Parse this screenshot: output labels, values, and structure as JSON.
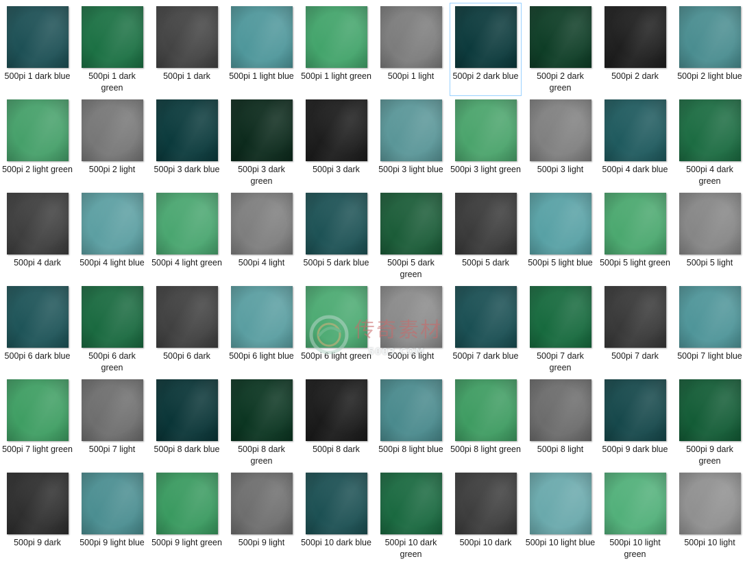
{
  "colors": {
    "dark blue": "#1c4e52",
    "dark green": "#1a6b42",
    "dark": "#3f3f3f",
    "light blue": "#4f9498",
    "light green": "#3fa06a",
    "light": "#7a7a7a",
    "selection_border": "#99d1ff"
  },
  "selected_index": 6,
  "items": [
    {
      "label": "500pi 1 dark blue",
      "swatch": "#1d5055"
    },
    {
      "label": "500pi 1 dark green",
      "swatch": "#1c7144"
    },
    {
      "label": "500pi 1 dark",
      "swatch": "#434343"
    },
    {
      "label": "500pi 1 light blue",
      "swatch": "#4f979b"
    },
    {
      "label": "500pi 1 light green",
      "swatch": "#43a46b"
    },
    {
      "label": "500pi 1 light",
      "swatch": "#7c7c7c"
    },
    {
      "label": "500pi 2 dark blue",
      "swatch": "#0c3a3c"
    },
    {
      "label": "500pi 2 dark green",
      "swatch": "#0e3d26"
    },
    {
      "label": "500pi 2 dark",
      "swatch": "#1e1e1e"
    },
    {
      "label": "500pi 2 light blue",
      "swatch": "#4a8d90"
    },
    {
      "label": "500pi 2 light green",
      "swatch": "#46a06a"
    },
    {
      "label": "500pi 2 light",
      "swatch": "#777777"
    },
    {
      "label": "500pi 3 dark blue",
      "swatch": "#0b3a3c"
    },
    {
      "label": "500pi 3 dark green",
      "swatch": "#0c2a1c"
    },
    {
      "label": "500pi 3 dark",
      "swatch": "#1c1c1c"
    },
    {
      "label": "500pi 3 light blue",
      "swatch": "#5a9698"
    },
    {
      "label": "500pi 3 light green",
      "swatch": "#4ba46c"
    },
    {
      "label": "500pi 3 light",
      "swatch": "#808080"
    },
    {
      "label": "500pi 4 dark blue",
      "swatch": "#1f5a5e"
    },
    {
      "label": "500pi 4 dark green",
      "swatch": "#1c6c42"
    },
    {
      "label": "500pi 4 dark",
      "swatch": "#3e3e3e"
    },
    {
      "label": "500pi 4 light blue",
      "swatch": "#5c9fa2"
    },
    {
      "label": "500pi 4 light green",
      "swatch": "#4aa670"
    },
    {
      "label": "500pi 4 light",
      "swatch": "#7e7e7e"
    },
    {
      "label": "500pi 5 dark blue",
      "swatch": "#1d5255"
    },
    {
      "label": "500pi 5 dark green",
      "swatch": "#1b5c38"
    },
    {
      "label": "500pi 5 dark",
      "swatch": "#3a3a3a"
    },
    {
      "label": "500pi 5 light blue",
      "swatch": "#58a1a5"
    },
    {
      "label": "500pi 5 light green",
      "swatch": "#4ba86f"
    },
    {
      "label": "500pi 5 light",
      "swatch": "#868686"
    },
    {
      "label": "500pi 6 dark blue",
      "swatch": "#1e5458"
    },
    {
      "label": "500pi 6 dark green",
      "swatch": "#1a6a40"
    },
    {
      "label": "500pi 6 dark",
      "swatch": "#404040"
    },
    {
      "label": "500pi 6 light blue",
      "swatch": "#5a9ea1"
    },
    {
      "label": "500pi 6 light green",
      "swatch": "#4caa72"
    },
    {
      "label": "500pi 6 light",
      "swatch": "#8a8a8a"
    },
    {
      "label": "500pi 7 dark blue",
      "swatch": "#1a4f53"
    },
    {
      "label": "500pi 7 dark green",
      "swatch": "#176a3e"
    },
    {
      "label": "500pi 7 dark",
      "swatch": "#383838"
    },
    {
      "label": "500pi 7 light blue",
      "swatch": "#4f9599"
    },
    {
      "label": "500pi 7 light green",
      "swatch": "#3f9e63"
    },
    {
      "label": "500pi 7 light",
      "swatch": "#6e6e6e"
    },
    {
      "label": "500pi 8 dark blue",
      "swatch": "#0a3537"
    },
    {
      "label": "500pi 8 dark green",
      "swatch": "#0b3521"
    },
    {
      "label": "500pi 8 dark",
      "swatch": "#1a1a1a"
    },
    {
      "label": "500pi 8 light blue",
      "swatch": "#4a8a8d"
    },
    {
      "label": "500pi 8 light green",
      "swatch": "#3f9c62"
    },
    {
      "label": "500pi 8 light",
      "swatch": "#6c6c6c"
    },
    {
      "label": "500pi 9 dark blue",
      "swatch": "#16484b"
    },
    {
      "label": "500pi 9 dark green",
      "swatch": "#135c36"
    },
    {
      "label": "500pi 9 dark",
      "swatch": "#2e2e2e"
    },
    {
      "label": "500pi 9 light blue",
      "swatch": "#4b8e91"
    },
    {
      "label": "500pi 9 light green",
      "swatch": "#3a9a60"
    },
    {
      "label": "500pi 9 light",
      "swatch": "#6e6e6e"
    },
    {
      "label": "500pi 10 dark blue",
      "swatch": "#1c5053"
    },
    {
      "label": "500pi 10 dark green",
      "swatch": "#1a6940"
    },
    {
      "label": "500pi 10 dark",
      "swatch": "#3d3d3d"
    },
    {
      "label": "500pi 10 light blue",
      "swatch": "#6aa9ac"
    },
    {
      "label": "500pi 10 light green",
      "swatch": "#52b07a"
    },
    {
      "label": "500pi 10 light",
      "swatch": "#909090"
    }
  ],
  "watermark": {
    "text": "传奇素材",
    "sub": "5003.COM"
  }
}
